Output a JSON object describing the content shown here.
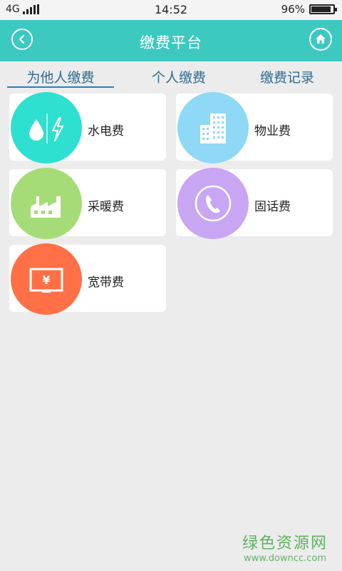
{
  "status_bar": {
    "network": "4G",
    "time": "14:52",
    "battery": "96%",
    "battery_level": 0.96
  },
  "header": {
    "title": "缴费平台",
    "back_icon": "chevron-left-icon",
    "home_icon": "home-icon"
  },
  "tabs": [
    {
      "label": "为他人缴费",
      "active": true
    },
    {
      "label": "个人缴费",
      "active": false
    },
    {
      "label": "缴费记录",
      "active": false
    }
  ],
  "services": [
    {
      "label": "水电费",
      "icon": "water-electricity-icon",
      "color": "#2ee0d0"
    },
    {
      "label": "物业费",
      "icon": "building-icon",
      "color": "#8fd8f6"
    },
    {
      "label": "采暖费",
      "icon": "factory-icon",
      "color": "#a6dc78"
    },
    {
      "label": "固话费",
      "icon": "telephone-icon",
      "color": "#c8a6f4"
    },
    {
      "label": "宽带费",
      "icon": "monitor-yen-icon",
      "color": "#ff7046"
    }
  ],
  "colors": {
    "accent": "#3cc9c0",
    "tab_text": "#2f6b8f",
    "background": "#ececec"
  },
  "watermark": {
    "title": "绿色资源网",
    "url": "www.downcc.com"
  }
}
